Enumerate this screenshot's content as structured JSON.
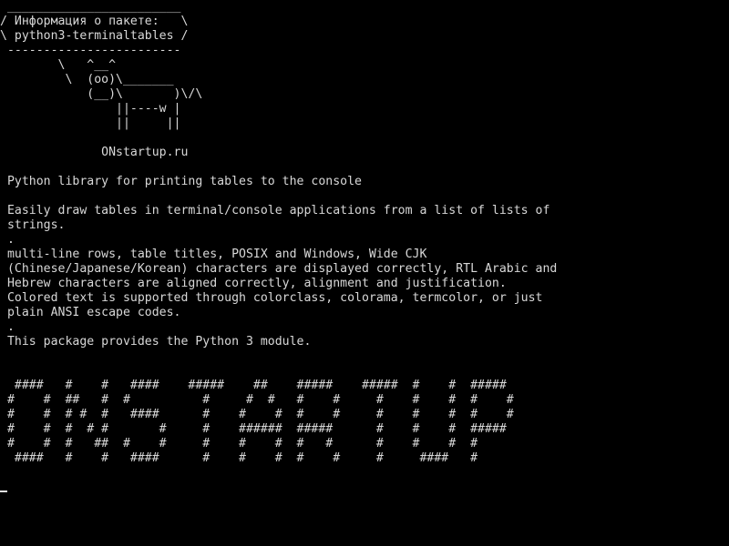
{
  "terminal": {
    "lines": [
      " ________________________",
      "/ Информация о пакете:   \\",
      "\\ python3-terminaltables /",
      " ------------------------",
      "        \\   ^__^",
      "         \\  (oo)\\_______",
      "            (__)\\       )\\/\\",
      "                ||----w |",
      "                ||     ||",
      "",
      "              ONstartup.ru",
      "",
      " Python library for printing tables to the console",
      "",
      " Easily draw tables in terminal/console applications from a list of lists of",
      " strings.",
      " .",
      " multi-line rows, table titles, POSIX and Windows, Wide CJK",
      " (Chinese/Japanese/Korean) characters are displayed correctly, RTL Arabic and",
      " Hebrew characters are aligned correctly, alignment and justification.",
      " Colored text is supported through colorclass, colorama, termcolor, or just",
      " plain ANSI escape codes.",
      " .",
      " This package provides the Python 3 module.",
      "",
      "",
      "  ####   #    #   ####    #####    ##    #####    #####  #    #  #####",
      " #    #  ##   #  #          #     #  #   #    #     #    #    #  #    #",
      " #    #  # #  #   ####      #    #    #  #    #     #    #    #  #    #",
      " #    #  #  # #       #     #    ######  #####      #    #    #  #####",
      " #    #  #   ##  #    #     #    #    #  #   #      #    #    #  #",
      "  ####   #    #   ####      #    #    #  #    #     #     ####   #"
    ]
  },
  "colors": {
    "background": "#000000",
    "text": "#d8d8d8",
    "cursor": "#e0e0e0"
  }
}
